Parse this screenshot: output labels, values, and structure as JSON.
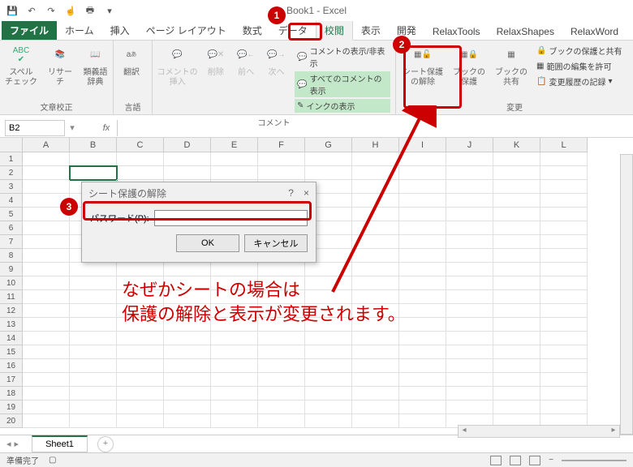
{
  "app": {
    "title": "Book1 - Excel"
  },
  "qat_icons": [
    "save-icon",
    "undo-icon",
    "redo-icon",
    "touch-icon",
    "print-icon",
    "dropdown-icon"
  ],
  "tabs": {
    "file": "ファイル",
    "items": [
      "ホーム",
      "挿入",
      "ページ レイアウト",
      "数式",
      "データ",
      "校閲",
      "表示",
      "開発",
      "RelaxTools",
      "RelaxShapes",
      "RelaxWord"
    ],
    "active": "校閲"
  },
  "ribbon": {
    "proofing": {
      "label": "文章校正",
      "spell": "スペル\nチェック",
      "research": "リサーチ",
      "thesaurus": "類義語\n辞典"
    },
    "language": {
      "label": "言語",
      "translate": "翻訳"
    },
    "comments": {
      "label": "コメント",
      "insert": "コメントの\n挿入",
      "delete": "削除",
      "prev": "前へ",
      "next": "次へ",
      "show_hide": "コメントの表示/非表示",
      "show_all": "すべてのコメントの表示",
      "show_ink": "インクの表示"
    },
    "changes": {
      "label": "変更",
      "unprotect_sheet": "シート保護\nの解除",
      "protect_book": "ブックの\n保護",
      "share_book": "ブックの\n共有",
      "protect_share": "ブックの保護と共有",
      "allow_ranges": "範囲の編集を許可",
      "track_changes": "変更履歴の記録"
    }
  },
  "formula_bar": {
    "namebox": "B2",
    "fx": "fx"
  },
  "columns": [
    "A",
    "B",
    "C",
    "D",
    "E",
    "F",
    "G",
    "H",
    "I",
    "J",
    "K",
    "L"
  ],
  "rows": 20,
  "dialog": {
    "title": "シート保護の解除",
    "help": "?",
    "close": "×",
    "password_label": "パスワード(P):",
    "ok": "OK",
    "cancel": "キャンセル"
  },
  "annotations": {
    "n1": "1",
    "n2": "2",
    "n3": "3",
    "text1": "なぜかシートの場合は",
    "text2": "保護の解除と表示が変更されます。"
  },
  "sheet": {
    "tab1": "Sheet1",
    "add": "+"
  },
  "statusbar": {
    "ready": "準備完了"
  }
}
